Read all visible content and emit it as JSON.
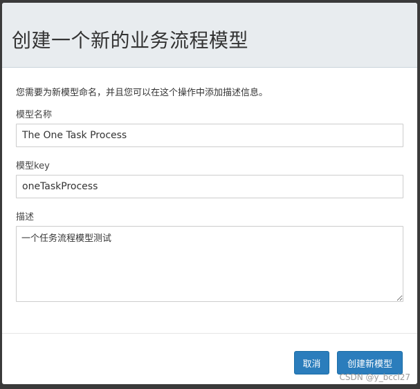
{
  "dialog": {
    "title": "创建一个新的业务流程模型",
    "intro": "您需要为新模型命名，并且您可以在这个操作中添加描述信息。"
  },
  "form": {
    "name_label": "模型名称",
    "name_value": "The One Task Process",
    "key_label": "模型key",
    "key_value": "oneTaskProcess",
    "description_label": "描述",
    "description_value": "一个任务流程模型测试"
  },
  "footer": {
    "cancel_label": "取消",
    "create_label": "创建新模型",
    "watermark": "CSDN @y_bccl27"
  },
  "colors": {
    "header_bg": "#e8ecef",
    "button_bg": "#2b7dbc"
  }
}
